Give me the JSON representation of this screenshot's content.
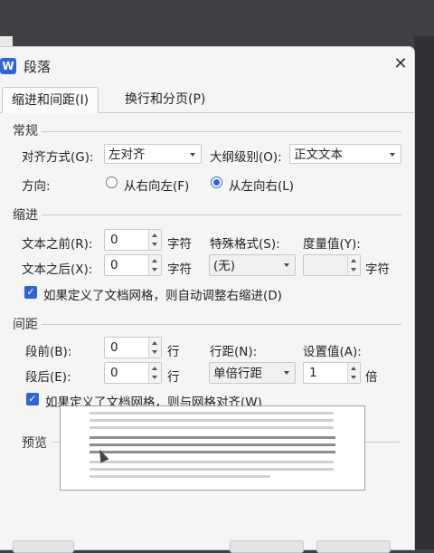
{
  "dialog": {
    "title": "段落",
    "app_logo_text": "W",
    "close_glyph": "✕"
  },
  "tabs": [
    {
      "label": "缩进和间距(I)",
      "active": true
    },
    {
      "label": "换行和分页(P)",
      "active": false
    }
  ],
  "general": {
    "section": "常规",
    "align_label": "对齐方式(G):",
    "align_value": "左对齐",
    "outline_label": "大纲级别(O):",
    "outline_value": "正文文本",
    "direction_label": "方向:",
    "rtl_label": "从右向左(F)",
    "ltr_label": "从左向右(L)",
    "direction_selected": "ltr"
  },
  "indent": {
    "section": "缩进",
    "before_label": "文本之前(R):",
    "before_value": "0",
    "before_unit": "字符",
    "after_label": "文本之后(X):",
    "after_value": "0",
    "after_unit": "字符",
    "special_label": "特殊格式(S):",
    "special_value": "(无)",
    "measure_label": "度量值(Y):",
    "measure_value": "",
    "measure_unit": "字符",
    "auto_adjust_label": "如果定义了文档网格，则自动调整右缩进(D)",
    "auto_adjust_checked": true
  },
  "spacing": {
    "section": "间距",
    "before_label": "段前(B):",
    "before_value": "0",
    "before_unit": "行",
    "after_label": "段后(E):",
    "after_value": "0",
    "after_unit": "行",
    "line_label": "行距(N):",
    "line_value": "单倍行距",
    "setting_label": "设置值(A):",
    "setting_value": "1",
    "setting_unit": "倍",
    "snap_grid_label": "如果定义了文档网格，则与网格对齐(W)",
    "snap_grid_checked": true
  },
  "preview": {
    "section": "预览"
  },
  "colors": {
    "accent": "#2f63d6",
    "dialog_bg": "#f5f5f6"
  }
}
